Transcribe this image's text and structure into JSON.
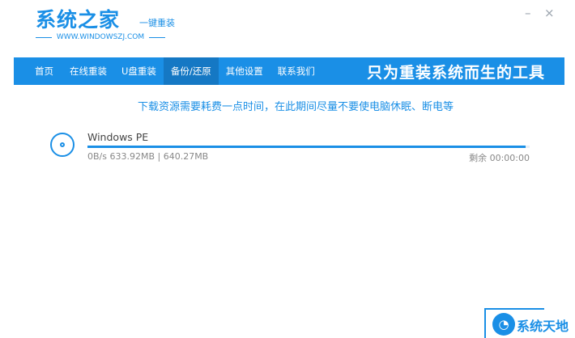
{
  "header": {
    "logo_main": "系统之家",
    "logo_sub": "一键重装",
    "logo_url": "WWW.WINDOWSZJ.COM",
    "minimize": "–",
    "close": "×"
  },
  "nav": {
    "items": [
      "首页",
      "在线重装",
      "U盘重装",
      "备份/还原",
      "其他设置",
      "联系我们"
    ],
    "active": "备份/还原",
    "slogan": "只为重装系统而生的工具"
  },
  "notice": "下载资源需要耗费一点时间，在此期间尽量不要使电脑休眠、断电等",
  "download": {
    "name": "Windows PE",
    "speed": "0B/s",
    "downloaded": "633.92MB",
    "total": "640.27MB",
    "size_text": "0B/s 633.92MB | 640.27MB",
    "remaining": "剩余 00:00:00",
    "progress": 0.99
  },
  "watermark": {
    "text": "系统天地",
    "icon": "xitong-tiandi-logo-icon"
  },
  "colors": {
    "accent": "#1a8fe6",
    "nav_active": "#1578c4"
  }
}
